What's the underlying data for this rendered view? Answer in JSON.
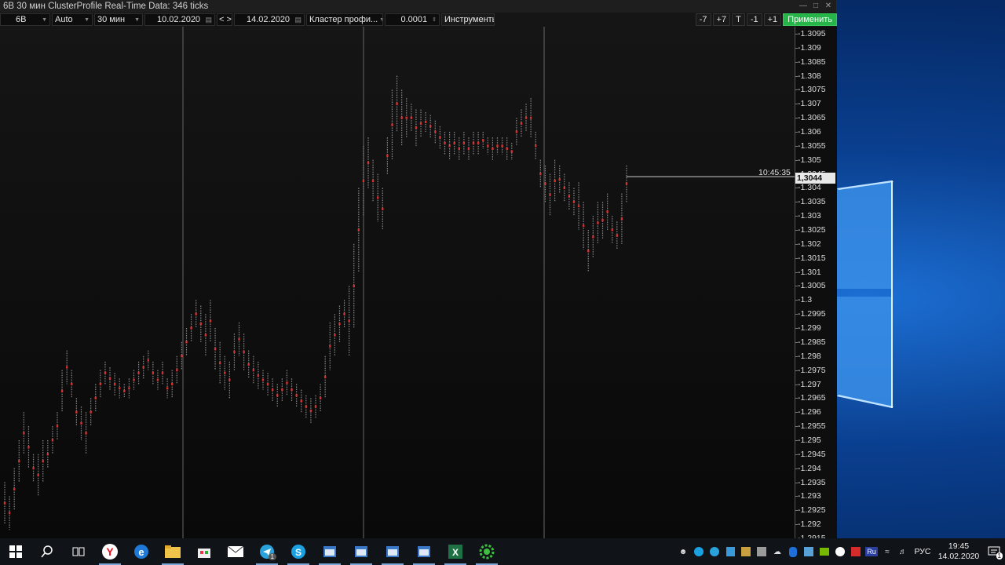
{
  "window": {
    "title": "6B 30 мин ClusterProfile Real-Time Data: 346 ticks",
    "controls": [
      "minimize-icon",
      "maximize-icon",
      "close-icon"
    ]
  },
  "toolbar": {
    "symbol": "6B",
    "scale": "Auto",
    "timeframe": "30 мин",
    "date_from": "10.02.2020",
    "nav": "< >",
    "date_to": "14.02.2020",
    "chart_type": "Кластер профи...",
    "step": "0.0001",
    "tools": "Инструменты",
    "btn_minus7": "-7",
    "btn_plus7": "+7",
    "btn_t": "T",
    "btn_minus1": "-1",
    "btn_plus1": "+1",
    "apply": "Применить"
  },
  "price_axis": {
    "ticks": [
      "1.3095",
      "1.309",
      "1.3085",
      "1.308",
      "1.3075",
      "1.307",
      "1.3065",
      "1.306",
      "1.3055",
      "1.305",
      "1.3045",
      "1.304",
      "1.3035",
      "1.303",
      "1.3025",
      "1.302",
      "1.3015",
      "1.301",
      "1.3005",
      "1.3",
      "1.2995",
      "1.299",
      "1.2985",
      "1.298",
      "1.2975",
      "1.297",
      "1.2965",
      "1.296",
      "1.2955",
      "1.295",
      "1.2945",
      "1.294",
      "1.2935",
      "1.293",
      "1.2925",
      "1.292",
      "1.2915"
    ],
    "display_prefix": "-",
    "current_price": "1,3044",
    "current_time": "10:45:35"
  },
  "chart_data": {
    "type": "bar",
    "description_source": "30-minute cluster profile bars, each shown as a vertical dotted range (low-high)",
    "ylim": [
      1.2915,
      1.3095
    ],
    "day_separators": [
      233,
      463,
      693
    ],
    "series": [
      {
        "name": "",
        "values": []
      }
    ],
    "ranges": [
      [
        1.292,
        1.2935
      ],
      [
        1.2918,
        1.293
      ],
      [
        1.2925,
        1.294
      ],
      [
        1.2935,
        1.295
      ],
      [
        1.2945,
        1.296
      ],
      [
        1.294,
        1.2955
      ],
      [
        1.2935,
        1.2945
      ],
      [
        1.293,
        1.2945
      ],
      [
        1.2935,
        1.295
      ],
      [
        1.294,
        1.295
      ],
      [
        1.2945,
        1.2955
      ],
      [
        1.295,
        1.296
      ],
      [
        1.296,
        1.2975
      ],
      [
        1.297,
        1.2982
      ],
      [
        1.2965,
        1.2975
      ],
      [
        1.2955,
        1.2965
      ],
      [
        1.295,
        1.2962
      ],
      [
        1.2945,
        1.296
      ],
      [
        1.2955,
        1.2965
      ],
      [
        1.296,
        1.297
      ],
      [
        1.2965,
        1.2975
      ],
      [
        1.297,
        1.2978
      ],
      [
        1.2968,
        1.2976
      ],
      [
        1.2966,
        1.2974
      ],
      [
        1.2965,
        1.2972
      ],
      [
        1.2965,
        1.297
      ],
      [
        1.2965,
        1.2972
      ],
      [
        1.2968,
        1.2975
      ],
      [
        1.297,
        1.2978
      ],
      [
        1.2972,
        1.298
      ],
      [
        1.2975,
        1.2982
      ],
      [
        1.297,
        1.2978
      ],
      [
        1.2968,
        1.2975
      ],
      [
        1.297,
        1.2978
      ],
      [
        1.2965,
        1.2972
      ],
      [
        1.2965,
        1.2975
      ],
      [
        1.297,
        1.298
      ],
      [
        1.2975,
        1.2985
      ],
      [
        1.298,
        1.299
      ],
      [
        1.2985,
        1.2995
      ],
      [
        1.299,
        1.3
      ],
      [
        1.2985,
        1.2998
      ],
      [
        1.298,
        1.2995
      ],
      [
        1.2985,
        1.3
      ],
      [
        1.2975,
        1.299
      ],
      [
        1.297,
        1.2985
      ],
      [
        1.2968,
        1.298
      ],
      [
        1.2965,
        1.2978
      ],
      [
        1.2975,
        1.2988
      ],
      [
        1.298,
        1.2992
      ],
      [
        1.2975,
        1.2988
      ],
      [
        1.2972,
        1.2982
      ],
      [
        1.297,
        1.298
      ],
      [
        1.2968,
        1.2978
      ],
      [
        1.2968,
        1.2975
      ],
      [
        1.2966,
        1.2974
      ],
      [
        1.2964,
        1.2972
      ],
      [
        1.2962,
        1.297
      ],
      [
        1.2964,
        1.2972
      ],
      [
        1.2966,
        1.2975
      ],
      [
        1.2964,
        1.2972
      ],
      [
        1.2962,
        1.297
      ],
      [
        1.296,
        1.2968
      ],
      [
        1.2958,
        1.2966
      ],
      [
        1.2956,
        1.2965
      ],
      [
        1.2958,
        1.2966
      ],
      [
        1.296,
        1.297
      ],
      [
        1.2965,
        1.298
      ],
      [
        1.2975,
        1.2992
      ],
      [
        1.298,
        1.2995
      ],
      [
        1.2985,
        1.2998
      ],
      [
        1.299,
        1.3
      ],
      [
        1.298,
        1.3005
      ],
      [
        1.299,
        1.302
      ],
      [
        1.301,
        1.304
      ],
      [
        1.303,
        1.3055
      ],
      [
        1.304,
        1.3058
      ],
      [
        1.3035,
        1.305
      ],
      [
        1.3028,
        1.3045
      ],
      [
        1.3025,
        1.304
      ],
      [
        1.3045,
        1.3058
      ],
      [
        1.305,
        1.3075
      ],
      [
        1.306,
        1.308
      ],
      [
        1.3055,
        1.3075
      ],
      [
        1.3058,
        1.3072
      ],
      [
        1.306,
        1.307
      ],
      [
        1.3055,
        1.3068
      ],
      [
        1.3058,
        1.3068
      ],
      [
        1.306,
        1.3067
      ],
      [
        1.3058,
        1.3066
      ],
      [
        1.3056,
        1.3064
      ],
      [
        1.3054,
        1.3062
      ],
      [
        1.3052,
        1.306
      ],
      [
        1.305,
        1.306
      ],
      [
        1.3052,
        1.306
      ],
      [
        1.305,
        1.3058
      ],
      [
        1.3052,
        1.306
      ],
      [
        1.305,
        1.3058
      ],
      [
        1.3052,
        1.306
      ],
      [
        1.3052,
        1.306
      ],
      [
        1.3054,
        1.306
      ],
      [
        1.3052,
        1.3058
      ],
      [
        1.305,
        1.3058
      ],
      [
        1.3052,
        1.3058
      ],
      [
        1.3052,
        1.3058
      ],
      [
        1.305,
        1.3058
      ],
      [
        1.305,
        1.3056
      ],
      [
        1.3055,
        1.3065
      ],
      [
        1.3058,
        1.3068
      ],
      [
        1.306,
        1.307
      ],
      [
        1.3058,
        1.3072
      ],
      [
        1.305,
        1.306
      ],
      [
        1.304,
        1.305
      ],
      [
        1.3035,
        1.3048
      ],
      [
        1.303,
        1.3045
      ],
      [
        1.3035,
        1.305
      ],
      [
        1.3038,
        1.3048
      ],
      [
        1.3035,
        1.3045
      ],
      [
        1.3032,
        1.3042
      ],
      [
        1.303,
        1.304
      ],
      [
        1.3025,
        1.3042
      ],
      [
        1.3018,
        1.3035
      ],
      [
        1.301,
        1.3025
      ],
      [
        1.3015,
        1.303
      ],
      [
        1.302,
        1.3035
      ],
      [
        1.3022,
        1.3035
      ],
      [
        1.3025,
        1.3038
      ],
      [
        1.302,
        1.303
      ],
      [
        1.3018,
        1.3028
      ],
      [
        1.302,
        1.3038
      ],
      [
        1.3035,
        1.3048
      ]
    ]
  },
  "taskbar": {
    "apps": [
      "windows-start-icon",
      "search-icon",
      "task-view-icon",
      "yandex-browser-icon",
      "edge-icon",
      "explorer-icon",
      "store-icon",
      "mail-icon",
      "telegram-icon",
      "skype-icon",
      "app-window-icon",
      "app-window-icon",
      "app-window-icon",
      "app-window-icon",
      "excel-icon",
      "gear-app-icon"
    ],
    "telegram_badge": "1",
    "tray": [
      "people-icon",
      "skype-tray-icon",
      "telegram-tray-icon",
      "shield-tray-icon",
      "app-tray-icon",
      "tool-tray-icon",
      "onedrive-icon",
      "bluetooth-icon",
      "cleaner-icon",
      "nvidia-icon",
      "yandex-tray-icon",
      "acrobat-tray-icon",
      "ru-tray-icon",
      "wifi-icon",
      "volume-icon"
    ],
    "ru_label": "Ru",
    "lang": "РУС",
    "time": "19:45",
    "date": "14.02.2020",
    "notification_badge": "1"
  },
  "colors": {
    "accent_green": "#27b54a",
    "bar_gray": "#8a8a8a",
    "bar_red": "#d83030",
    "wallpaper_blue": "#1c6fd4"
  }
}
